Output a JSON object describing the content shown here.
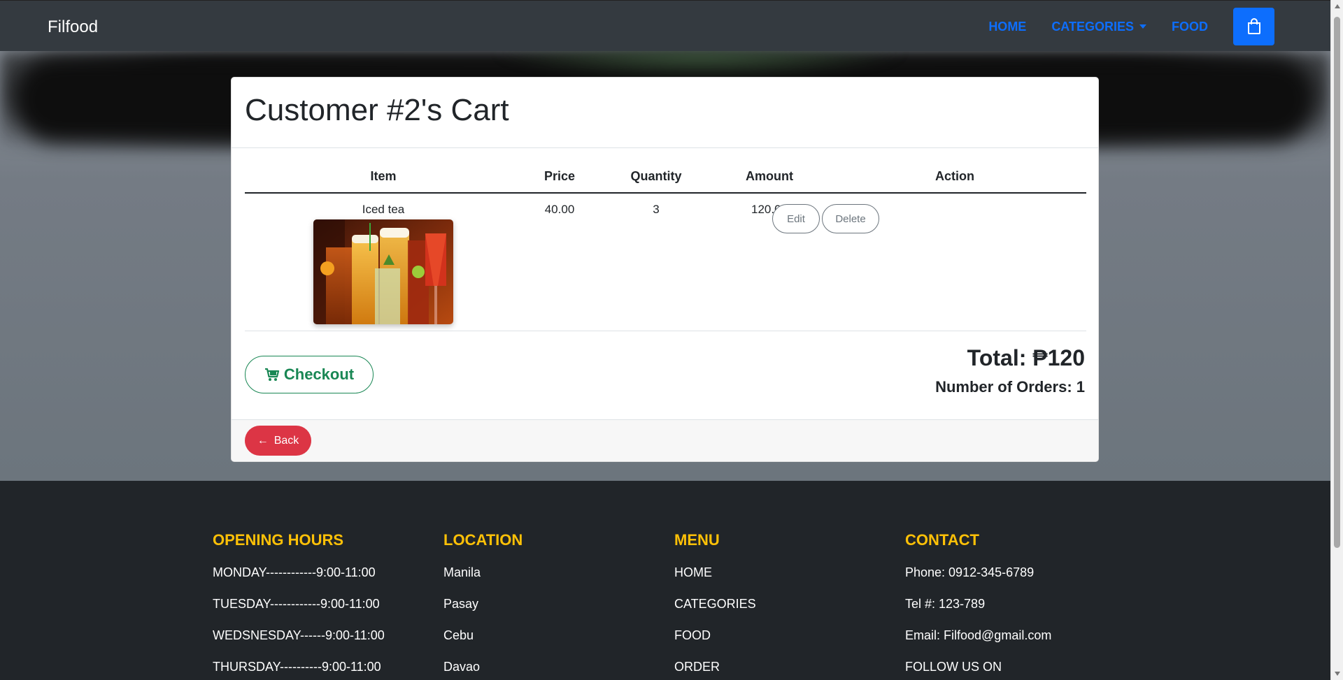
{
  "navbar": {
    "brand": "Filfood",
    "links": {
      "home": "HOME",
      "categories": "CATEGORIES",
      "food": "FOOD"
    },
    "cart_icon": "shopping-bag-icon"
  },
  "cart": {
    "title": "Customer #2's Cart",
    "columns": {
      "item": "Item",
      "price": "Price",
      "quantity": "Quantity",
      "amount": "Amount",
      "action": "Action"
    },
    "rows": [
      {
        "item": "Iced tea",
        "price": "40.00",
        "quantity": "3",
        "amount": "120.00",
        "edit": "Edit",
        "delete": "Delete"
      }
    ],
    "checkout_label": "Checkout",
    "total": "Total: ₱120",
    "orders": "Number of Orders: 1",
    "back_label": "Back"
  },
  "footer": {
    "hours": {
      "title": "OPENING HOURS",
      "items": [
        "MONDAY------------9:00-11:00",
        "TUESDAY------------9:00-11:00",
        "WEDSNESDAY------9:00-11:00",
        "THURSDAY----------9:00-11:00"
      ]
    },
    "location": {
      "title": "LOCATION",
      "items": [
        "Manila",
        "Pasay",
        "Cebu",
        "Davao"
      ]
    },
    "menu": {
      "title": "MENU",
      "items": [
        "HOME",
        "CATEGORIES",
        "FOOD",
        "ORDER"
      ]
    },
    "contact": {
      "title": "CONTACT",
      "items": [
        "Phone: 0912-345-6789",
        "Tel #: 123-789",
        "Email: Filfood@gmail.com",
        "FOLLOW US ON"
      ]
    }
  },
  "colors": {
    "accent": "#0d6efd",
    "success": "#198754",
    "danger": "#dc3545",
    "footer_heading": "#ffc107",
    "navbar_bg": "#343a40",
    "footer_bg": "#212529"
  }
}
